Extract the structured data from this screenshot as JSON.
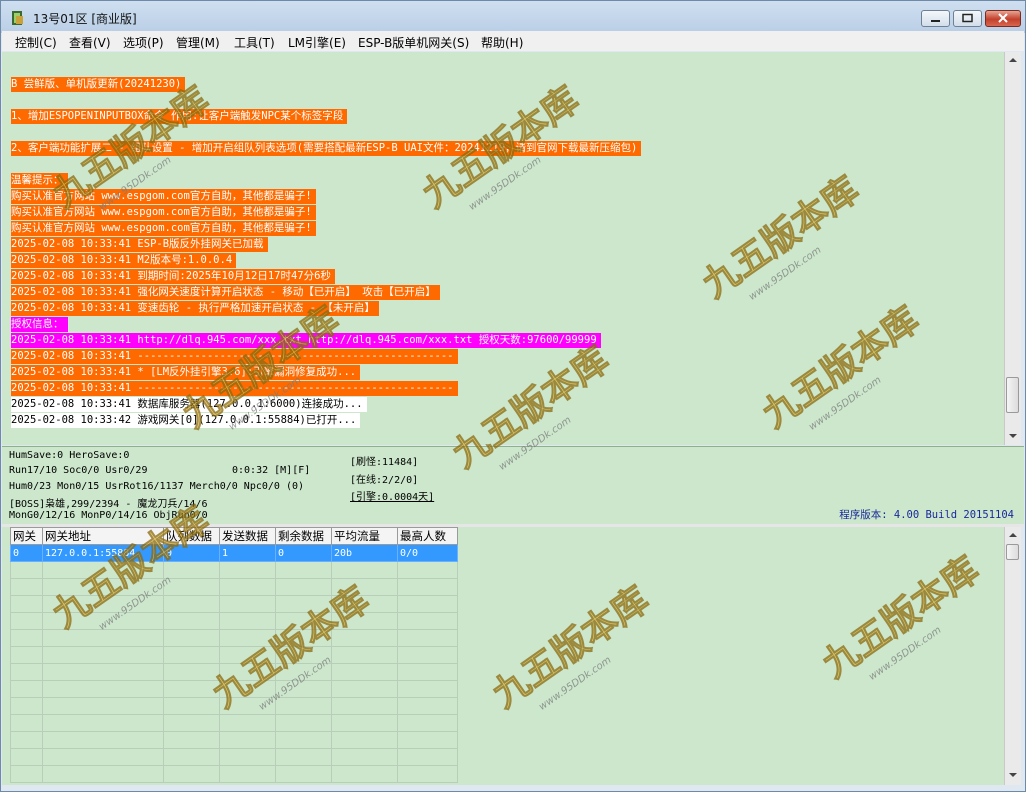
{
  "window": {
    "title": "13号01区 [商业版]"
  },
  "menu": [
    "控制(C)",
    "查看(V)",
    "选项(P)",
    "管理(M)",
    "工具(T)",
    "LM引擎(E)",
    "ESP-B版单机网关(S)",
    "帮助(H)"
  ],
  "log": [
    {
      "text": "B 尝鲜版、单机版更新(20241230)",
      "bg": "#ff6a00",
      "fg": "#ffffff"
    },
    {
      "text": "",
      "bg": "",
      "fg": ""
    },
    {
      "text": "1、增加ESPOPENINPUTBOX命令 作用:让客户端触发NPC某个标签字段",
      "bg": "#ff6a00",
      "fg": "#ffffff"
    },
    {
      "text": "",
      "bg": "",
      "fg": ""
    },
    {
      "text": "2、客户端功能扩展二 - 组队设置 - 增加开启组队列表选项(需要搭配最新ESP-B UAI文件：20241219，请到官网下载最新压缩包)",
      "bg": "#ff6a00",
      "fg": "#ffffff"
    },
    {
      "text": "",
      "bg": "",
      "fg": ""
    },
    {
      "text": "温馨提示：",
      "bg": "#ff6a00",
      "fg": "#ffffff"
    },
    {
      "text": "购买认准官方网站 www.espgom.com官方自助，其他都是骗子!",
      "bg": "#ff6a00",
      "fg": "#ffffff"
    },
    {
      "text": "购买认准官方网站 www.espgom.com官方自助，其他都是骗子!",
      "bg": "#ff6a00",
      "fg": "#ffffff"
    },
    {
      "text": "购买认准官方网站 www.espgom.com官方自助，其他都是骗子!",
      "bg": "#ff6a00",
      "fg": "#ffffff"
    },
    {
      "text": "2025-02-08 10:33:41 ESP-B版反外挂网关已加载",
      "bg": "#ff6a00",
      "fg": "#ffffff"
    },
    {
      "text": "2025-02-08 10:33:41 M2版本号:1.0.0.4",
      "bg": "#ff6a00",
      "fg": "#ffffff"
    },
    {
      "text": "2025-02-08 10:33:41 到期时间:2025年10月12日17时47分6秒",
      "bg": "#ff6a00",
      "fg": "#ffffff"
    },
    {
      "text": "2025-02-08 10:33:41 强化网关速度计算开启状态 - 移动【已开启】 攻击【已开启】",
      "bg": "#ff6a00",
      "fg": "#ffffff"
    },
    {
      "text": "2025-02-08 10:33:41 变速齿轮 - 执行严格加速开启状态 - 【未开启】",
      "bg": "#ff6a00",
      "fg": "#ffffff"
    },
    {
      "text": "授权信息：",
      "bg": "#ff00ff",
      "fg": "#ffffff"
    },
    {
      "text": "2025-02-08 10:33:41 http://dlq.945.com/xxx.txt http://dlq.945.com/xxx.txt 授权天数:97600/99999",
      "bg": "#ff00ff",
      "fg": "#ffffff"
    },
    {
      "text": "2025-02-08 10:33:41 --------------------------------------------------",
      "bg": "#ff6a00",
      "fg": "#ffffff"
    },
    {
      "text": "2025-02-08 10:33:41 * [LM反外挂引擎3.6]:引擎漏洞修复成功...",
      "bg": "#ff6a00",
      "fg": "#ffffff"
    },
    {
      "text": "2025-02-08 10:33:41 --------------------------------------------------",
      "bg": "#ff6a00",
      "fg": "#ffffff"
    },
    {
      "text": "2025-02-08 10:33:41 数据库服务器(127.0.0.1:6000)连接成功...",
      "bg": "#ffffff",
      "fg": "#000000"
    },
    {
      "text": "2025-02-08 10:33:42 游戏网关[0](127.0.0.1:55884)已打开...",
      "bg": "#ffffff",
      "fg": "#000000"
    }
  ],
  "status": {
    "hum_save": "HumSave:0 HeroSave:0",
    "run_line": "Run17/10 Soc0/0 Usr0/29",
    "timer": "0:0:32 [M][F]",
    "hum_line": "Hum0/23 Mon0/15 UsrRot16/1137 Merch0/0 Npc0/0 (0)",
    "boss_line": "[BOSS]枭雄,299/2394 - 魔龙刀兵/14/6",
    "mon_line": "MonG0/12/16 MonP0/14/16 ObjRun0/0",
    "refresh": "[刷怪:11484]",
    "online": "[在线:2/2/0]",
    "engine": "[引擎:0.0004天]",
    "version": "程序版本: 4.00 Build 20151104"
  },
  "gateway_table": {
    "headers": [
      "网关",
      "网关地址",
      "队列数据",
      "发送数据",
      "剩余数据",
      "平均流量",
      "最高人数"
    ],
    "rows": [
      [
        "0",
        "127.0.0.1:55884",
        "0",
        "1",
        "0",
        "20b",
        "0/0"
      ]
    ],
    "empty_rows": 13
  },
  "watermark": {
    "brand": "九五版本库",
    "url": "www.95DDk.com",
    "color": "#e8c24a"
  }
}
